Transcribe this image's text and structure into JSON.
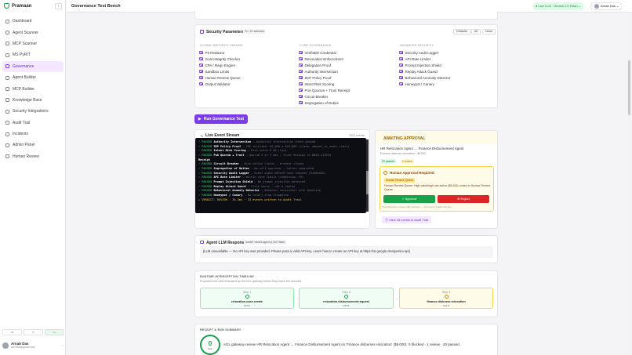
{
  "app": {
    "name": "Pramaan",
    "collapse_icon": "‹"
  },
  "sidebar": {
    "items": [
      {
        "label": "Dashboard",
        "active": false
      },
      {
        "label": "Agent Scanner",
        "active": false
      },
      {
        "label": "MCP Scanner",
        "active": false
      },
      {
        "label": "MS PyRIT",
        "active": false
      },
      {
        "label": "Governance",
        "active": true
      },
      {
        "label": "Agent Builder",
        "active": false
      },
      {
        "label": "MCP Builder",
        "active": false
      },
      {
        "label": "Knowledge Base",
        "active": false
      },
      {
        "label": "Security Integrations",
        "active": false
      },
      {
        "label": "Audit Trail",
        "active": false
      },
      {
        "label": "Incidents",
        "active": false
      },
      {
        "label": "Admin Panel",
        "active": false
      },
      {
        "label": "Human Review",
        "active": false
      }
    ],
    "footer_buttons": [
      "▭",
      "◐",
      "☼"
    ],
    "user": {
      "name": "Arnab Das",
      "email": "ad7955@gmail.com",
      "menu": "···"
    }
  },
  "topbar": {
    "title": "Governance Test Bench",
    "llm_badge": "● Live LLM · Gemini 2.5 Flash ⌄",
    "user": "Arnab Das ⌄"
  },
  "security": {
    "title": "Security Parameters",
    "count": "21 / 21 selected",
    "buttons": [
      "Defaults",
      "All",
      "None"
    ],
    "columns": [
      {
        "heading": "Global Security Params",
        "items": [
          "PII Redactor",
          "Goal Integrity Checker",
          "CPA / Rego Engine",
          "Sandbox Limits",
          "Human Review Queue",
          "Output Validator"
        ]
      },
      {
        "heading": "Core Governance",
        "items": [
          "Verifiable Credential",
          "Revocation Enforcement",
          "Delegation Proof",
          "Authority Intersection",
          "ZKP Policy Proof",
          "Intent Risk Scoring",
          "PoA Quorum + Trust Receipt",
          "Circuit Breaker",
          "Segregation of Duties"
        ]
      },
      {
        "heading": "Advanced Security",
        "items": [
          "Security Audit Logger",
          "API Rate Limiter",
          "Prompt Injection Shield",
          "Replay Attack Guard",
          "Behavioral Anomaly Detector",
          "Honeypot / Canary"
        ]
      }
    ]
  },
  "run_button": {
    "label": "Run Governance Test",
    "icon": "▶"
  },
  "stream": {
    "title": "Live Event Stream",
    "count": "2023 events",
    "lines": [
      {
        "status": "✓ PASSED",
        "label": "Authority Intersection",
        "desc": "— Authority intersection check passed"
      },
      {
        "status": "✓ PASSED",
        "label": "ZKP Policy Proof",
        "desc": "— ZKP verified: $5,000 ≤ $10,000 (claim: amount_is_under_limit)"
      },
      {
        "status": "✓ PASSED",
        "label": "Intent Risk Scoring",
        "desc": "— Risk score 0.00 (low)"
      },
      {
        "status": "✓ PASSED",
        "label": "PoA Quorum + Trust",
        "desc": "— Quorum 1 of 3 met — Trust Receipt tr-0816-211524"
      },
      {
        "status": "",
        "label": "Receipt",
        "desc": ""
      },
      {
        "status": "✓ PASSED",
        "label": "Circuit Breaker",
        "desc": "— Risk within limits — breaker closed"
      },
      {
        "status": "✓ PASSED",
        "label": "Segregation of Duties",
        "desc": "— No self-approval — duties separated"
      },
      {
        "status": "✓ PASSED",
        "label": "Security Audit Logger",
        "desc": "— Event audit-0d7af9 hash chained (8fd0a4b2)"
      },
      {
        "status": "✓ PASSED",
        "label": "API Rate Limiter",
        "desc": "— Within rate limits (remaining: 19)"
      },
      {
        "status": "✓ PASSED",
        "label": "Prompt Injection Shield",
        "desc": "— No prompt injection detected"
      },
      {
        "status": "✓ PASSED",
        "label": "Replay Attack Guard",
        "desc": "— Fresh nonce — not a replay"
      },
      {
        "status": "✓ PASSED",
        "label": "Behavioral Anomaly Detector",
        "desc": "— Behavior consistent with baseline"
      },
      {
        "status": "✓ PASSED",
        "label": "Honeypot / Canary",
        "desc": "— No canary trap triggered"
      }
    ],
    "verdict": "▸ VERDICT: REVIEW · 35.3ms · 33 events written to Audit Trail"
  },
  "approval": {
    "title": "AWAITING APPROVAL",
    "flow": "HR Relocation Agent → Finance Disbursement Agent",
    "sub": "Finance disburse relocation · $5,000",
    "pills": [
      "20 passed",
      "1 review"
    ],
    "box_title": "Human Approval Required",
    "box_tag": "Human Review Queue",
    "box_text": "Human Review Queue: High value/high risk action ($5,000) routed to Human Review Queue.",
    "approve": "✓ Approve",
    "reject": "⊗ Reject",
    "note": "Trust Receipt is issued after decision — Approve to finalize the flow.",
    "audit_link": "Ⓥ View 33 events in Audit Trail"
  },
  "llm_response": {
    "title": "Agent LLM Response",
    "tag": "model: mixed-agent (LLM Flash)",
    "text": "[LLM unavailable — No API key was provided. Please pass a valid API key. Learn how to create an API key at https://ai.google.dev/gemini-api]"
  },
  "timeline": {
    "title": "Runtime Interception Timeline",
    "subtitle": "Proposed tool calls evaluated by the AGL gateway before they reach the executor",
    "steps": [
      {
        "step": "Step 1",
        "name": "relocation.case.create",
        "status": "PASS"
      },
      {
        "step": "Step 2",
        "name": "relocation.disbursement.request",
        "status": "PASS"
      },
      {
        "step": "Step 3",
        "name": "finance.disburse.relocation",
        "status": "HOLD"
      }
    ],
    "arrow": "→"
  },
  "summary": {
    "title": "Receipt & Run Summary",
    "score": "0",
    "score_label": "Risk",
    "text": "AGL gateway review HR Relocation Agent → Finance Disbursement Agent on 'Finance disburses relocation' ($5,000): 0 blocked · 1 review · 20 passed."
  },
  "colors": {
    "accent": "#7c3aed",
    "pass": "#16a34a",
    "hold": "#ca8a04"
  }
}
